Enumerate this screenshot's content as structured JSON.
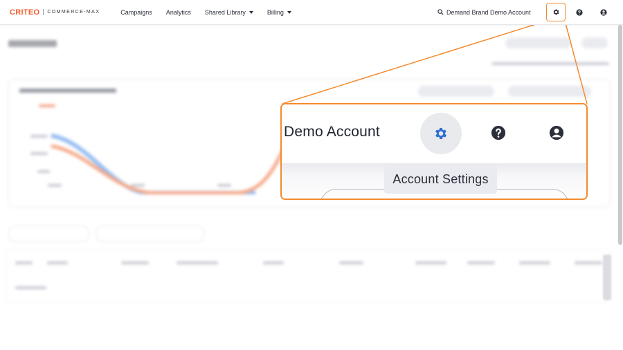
{
  "header": {
    "logo_brand": "CRITEO",
    "logo_product": "COMMERCE-MAX",
    "nav": [
      {
        "label": "Campaigns",
        "dropdown": false
      },
      {
        "label": "Analytics",
        "dropdown": false
      },
      {
        "label": "Shared Library",
        "dropdown": true
      },
      {
        "label": "Billing",
        "dropdown": true
      }
    ],
    "account_name": "Demand Brand Demo Account",
    "icons": [
      "search-icon",
      "gear-icon",
      "help-icon",
      "user-icon"
    ]
  },
  "callout": {
    "account_label": "Demo Account",
    "tooltip": "Account Settings",
    "icons": [
      "gear-icon",
      "help-icon",
      "user-icon"
    ]
  },
  "colors": {
    "brand": "#f25c2a",
    "highlight": "#f58a2c",
    "settings_icon": "#2f6fd1",
    "icon_dark": "#2b2f3a",
    "chart_blue": "#8cb6f2",
    "chart_orange": "#f6a07c"
  }
}
